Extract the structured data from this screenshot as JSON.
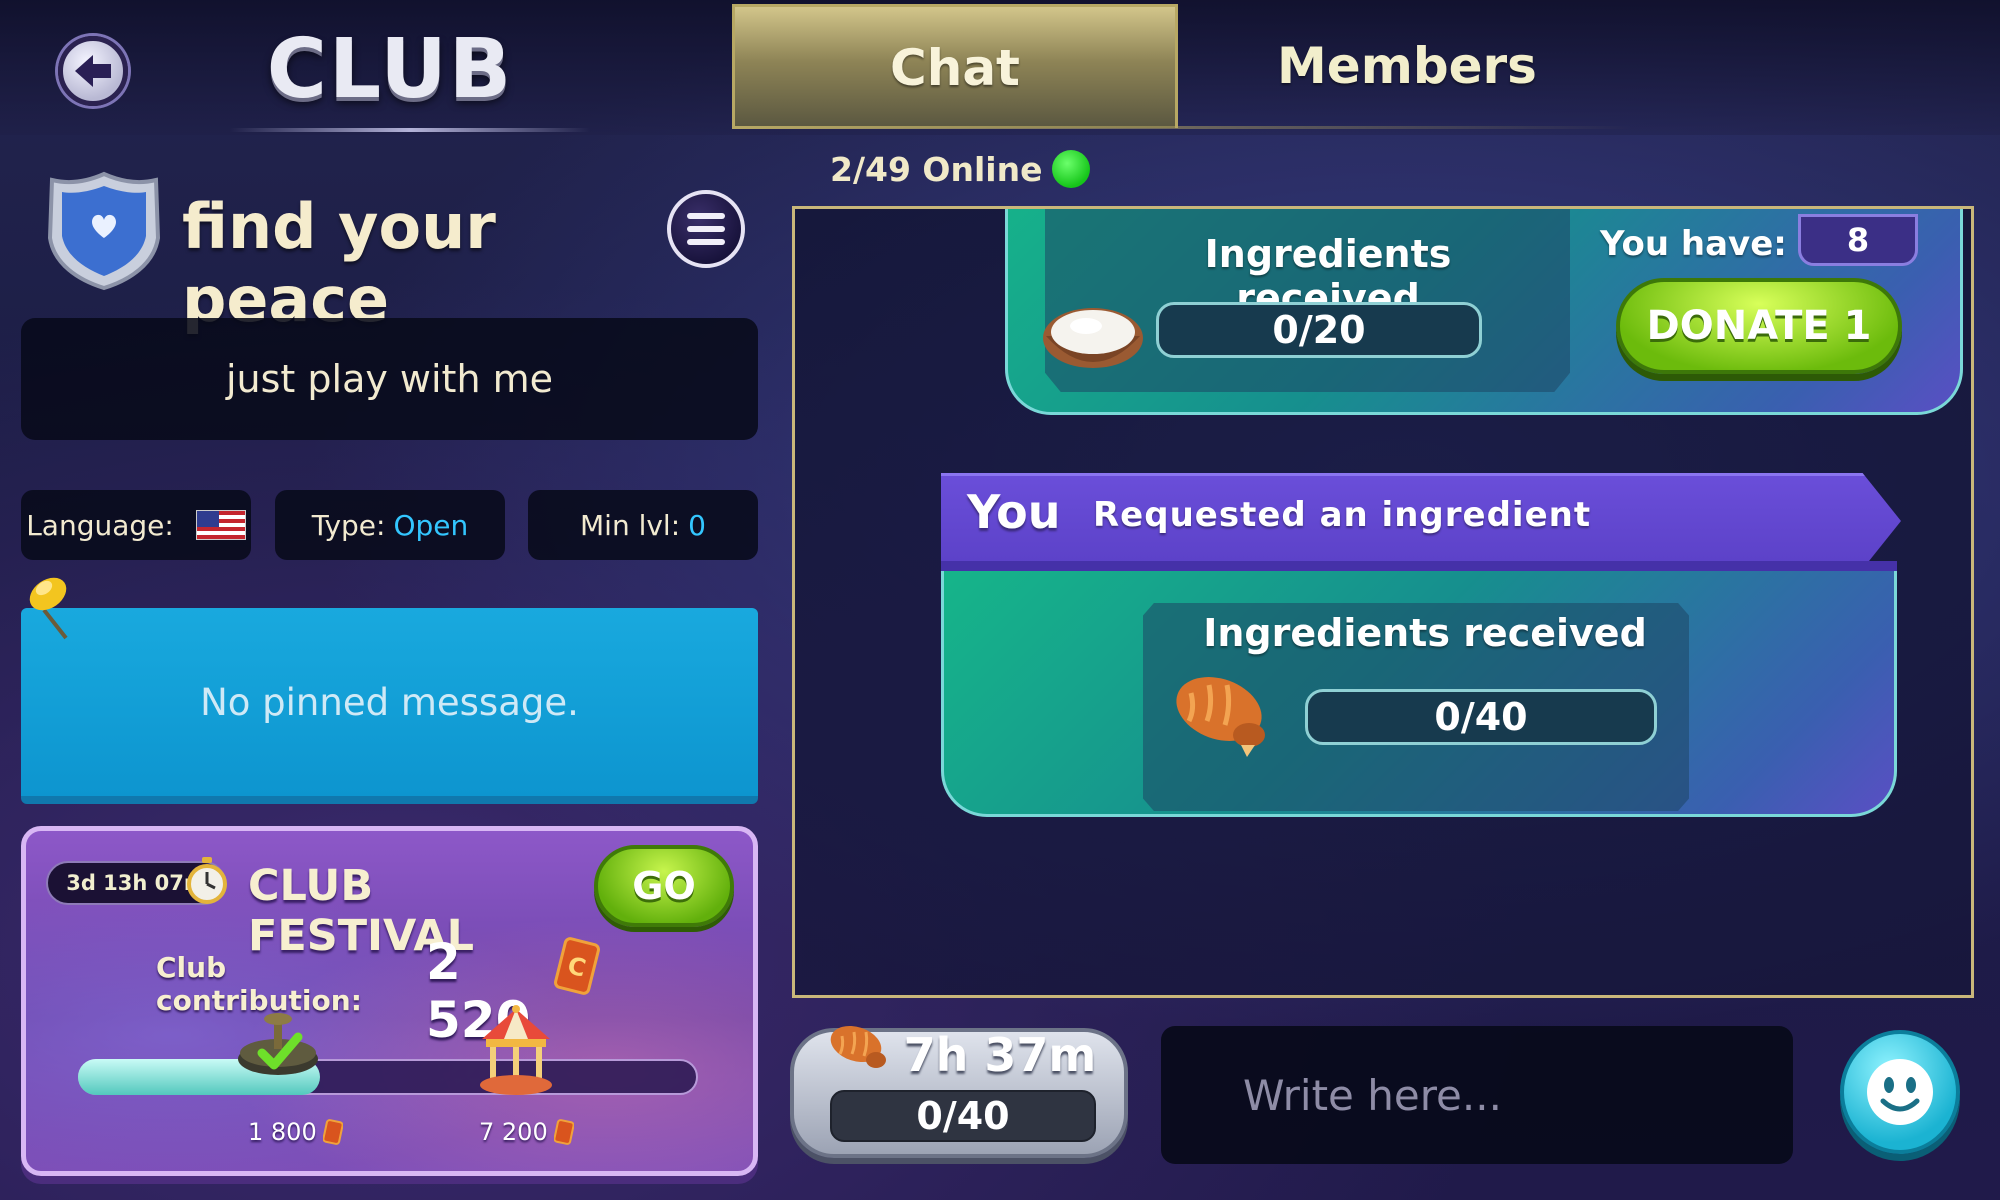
{
  "header": {
    "title": "CLUB",
    "tabs": [
      {
        "label": "Chat",
        "active": true
      },
      {
        "label": "Members",
        "active": false
      }
    ],
    "online": "2/49 Online"
  },
  "club": {
    "name": "find your peace",
    "description": "just play with me",
    "language_label": "Language:",
    "type_label": "Type:",
    "type_value": "Open",
    "min_level_label": "Min lvl:",
    "min_level_value": "0",
    "pinned_message": "No pinned message."
  },
  "festival": {
    "timer": "3d 13h 07m",
    "title": "CLUB FESTIVAL",
    "go_label": "GO",
    "contribution_label": "Club contribution:",
    "contribution_value": "2 520",
    "progress_fraction": 0.39,
    "milestones": [
      {
        "label": "1 800",
        "completed": true
      },
      {
        "label": "7 200",
        "completed": false
      }
    ]
  },
  "chat": {
    "messages": [
      {
        "ingredients_label": "Ingredients received",
        "progress": "0/20",
        "you_have_label": "You have:",
        "you_have_value": "8",
        "donate_label": "DONATE 1",
        "ingredient_icon": "rice-bowl-icon"
      },
      {
        "sender": "You",
        "subtitle": "Requested an ingredient",
        "ingredients_label": "Ingredients received",
        "progress": "0/40",
        "ingredient_icon": "bread-icon"
      }
    ]
  },
  "request": {
    "timer": "7h 37m",
    "progress": "0/40"
  },
  "input": {
    "placeholder": "Write here..."
  },
  "colors": {
    "accent_blue": "#33c6ff",
    "online_green": "#16c51a",
    "button_green": "#6cbb0c",
    "card_teal": "#16b58a",
    "header_purple": "#5b41c7"
  }
}
